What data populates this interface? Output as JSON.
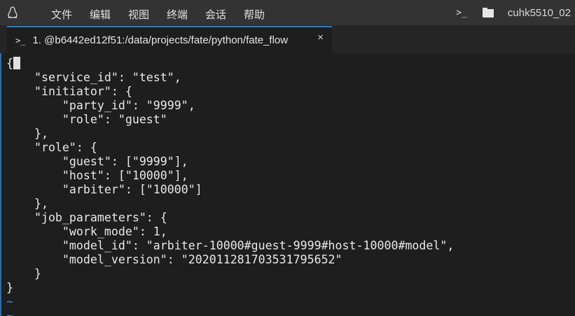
{
  "menubar": {
    "items": [
      "文件",
      "编辑",
      "视图",
      "终端",
      "会话",
      "帮助"
    ],
    "host": "cuhk5510_02"
  },
  "tab": {
    "title": "1. @b6442ed12f51:/data/projects/fate/python/fate_flow",
    "close": "×"
  },
  "terminal": {
    "lines": [
      "{",
      "    \"service_id\": \"test\",",
      "    \"initiator\": {",
      "        \"party_id\": \"9999\",",
      "        \"role\": \"guest\"",
      "    },",
      "    \"role\": {",
      "        \"guest\": [\"9999\"],",
      "        \"host\": [\"10000\"],",
      "        \"arbiter\": [\"10000\"]",
      "    },",
      "    \"job_parameters\": {",
      "        \"work_mode\": 1,",
      "        \"model_id\": \"arbiter-10000#guest-9999#host-10000#model\",",
      "        \"model_version\": \"20201128170353179565 2\"",
      "    }",
      "}"
    ],
    "tildes": [
      "~",
      "~"
    ]
  },
  "colors": {
    "accent": "#1f7fd4",
    "tilde": "#3b8eea"
  }
}
